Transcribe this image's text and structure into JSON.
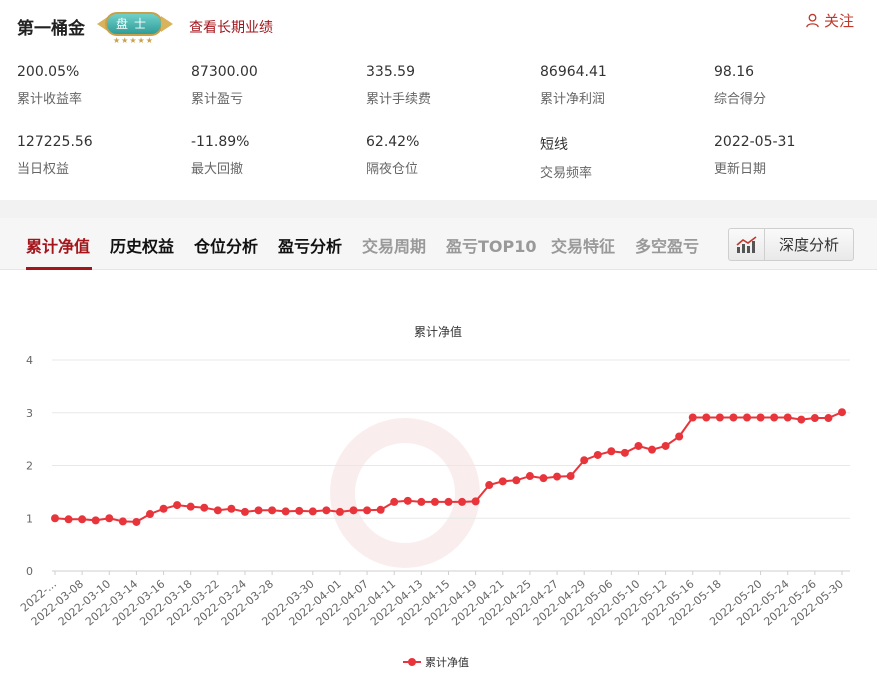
{
  "header": {
    "title": "第一桶金",
    "badge_text": "盘士",
    "badge_stars": "★★★★★",
    "history_link": "查看长期业绩",
    "follow_label": "关注"
  },
  "stats_row1": [
    {
      "value": "200.05%",
      "label": "累计收益率"
    },
    {
      "value": "87300.00",
      "label": "累计盈亏"
    },
    {
      "value": "335.59",
      "label": "累计手续费"
    },
    {
      "value": "86964.41",
      "label": "累计净利润"
    },
    {
      "value": "98.16",
      "label": "综合得分"
    }
  ],
  "stats_row2": [
    {
      "value": "127225.56",
      "label": "当日权益"
    },
    {
      "value": "-11.89%",
      "label": "最大回撤"
    },
    {
      "value": "62.42%",
      "label": "隔夜仓位"
    },
    {
      "value": "短线",
      "label": "交易频率"
    },
    {
      "value": "2022-05-31",
      "label": "更新日期"
    }
  ],
  "tabs": [
    {
      "label": "累计净值",
      "state": "active"
    },
    {
      "label": "历史权益",
      "state": "normal"
    },
    {
      "label": "仓位分析",
      "state": "normal"
    },
    {
      "label": "盈亏分析",
      "state": "normal"
    },
    {
      "label": "交易周期",
      "state": "gray"
    },
    {
      "label": "盈亏TOP10",
      "state": "gray"
    },
    {
      "label": "交易特征",
      "state": "gray"
    },
    {
      "label": "多空盈亏",
      "state": "gray"
    }
  ],
  "deep_button": {
    "label": "深度分析",
    "icon": "bar-chart-icon"
  },
  "colors": {
    "accent": "#a3151b",
    "series": "#e8353b"
  },
  "chart_data": {
    "type": "line",
    "title": "累计净值",
    "ylim": [
      0,
      4
    ],
    "yticks": [
      0,
      1,
      2,
      3,
      4
    ],
    "grid": true,
    "legend": "bottom-center",
    "tick_labels": [
      "2022-...",
      "2022-03-08",
      "2022-03-10",
      "2022-03-14",
      "2022-03-16",
      "2022-03-18",
      "2022-03-22",
      "2022-03-24",
      "2022-03-28",
      "2022-03-30",
      "2022-04-01",
      "2022-04-07",
      "2022-04-11",
      "2022-04-13",
      "2022-04-15",
      "2022-04-19",
      "2022-04-21",
      "2022-04-25",
      "2022-04-27",
      "2022-04-29",
      "2022-05-06",
      "2022-05-10",
      "2022-05-12",
      "2022-05-16",
      "2022-05-18",
      "2022-05-20",
      "2022-05-24",
      "2022-05-26",
      "2022-05-30"
    ],
    "series": [
      {
        "name": "累计净值",
        "values": [
          1.0,
          0.98,
          0.98,
          0.96,
          1.0,
          0.94,
          0.93,
          1.08,
          1.18,
          1.25,
          1.22,
          1.2,
          1.15,
          1.18,
          1.12,
          1.15,
          1.15,
          1.13,
          1.14,
          1.13,
          1.15,
          1.12,
          1.15,
          1.15,
          1.16,
          1.31,
          1.33,
          1.31,
          1.31,
          1.31,
          1.31,
          1.32,
          1.63,
          1.7,
          1.72,
          1.8,
          1.76,
          1.79,
          1.8,
          2.1,
          2.2,
          2.27,
          2.24,
          2.37,
          2.3,
          2.37,
          2.55,
          2.91,
          2.91,
          2.91,
          2.91,
          2.91,
          2.91,
          2.91,
          2.91,
          2.87,
          2.9,
          2.9,
          3.01
        ]
      }
    ]
  }
}
